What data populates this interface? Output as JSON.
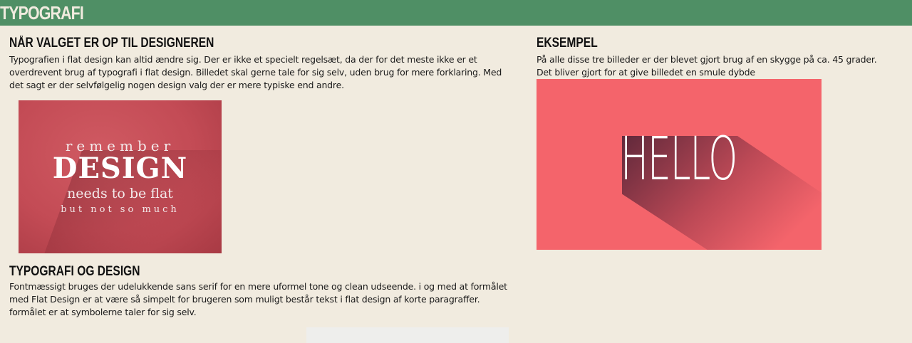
{
  "header": {
    "title": "TYPOGRAFI"
  },
  "section1": {
    "heading": "NÅR VALGET ER OP TIL DESIGNEREN",
    "lines": [
      "Typografien i flat design kan altid ændre sig. Der er ikke et specielt regelsæt, da der for det meste ikke er et",
      "overdrevent brug af typografi i flat design. Billedet skal gerne tale for sig selv, uden brug for mere forklaring. Med",
      "det sagt er der selvfølgelig nogen design valg der er mere typiske end andre."
    ],
    "image": {
      "line1": "remember",
      "line2": "DESIGN",
      "line3": "needs to be flat",
      "line4": "but not so much"
    }
  },
  "section2": {
    "heading": "TYPOGRAFI OG DESIGN",
    "lines": [
      "Fontmæssigt bruges der udelukkende sans serif for en mere uformel tone og clean udseende. i og med at formålet",
      "med Flat Design er at være så simpelt for brugeren som muligt består tekst i flat design af korte paragraffer.",
      "formålet er at symbolerne taler for sig selv."
    ]
  },
  "section3": {
    "heading": "EKSEMPEL",
    "lines": [
      "På alle disse tre billeder er der blevet gjort brug af en skygge på ca. 45 grader.",
      "Det bliver gjort for at give billedet en smule dybde"
    ],
    "image": {
      "word": "HELLO"
    }
  },
  "colors": {
    "header_bg": "#4f8f65",
    "page_bg": "#f1ebdf",
    "image_red": "#c34b55",
    "hello_bg": "#f4646b"
  }
}
